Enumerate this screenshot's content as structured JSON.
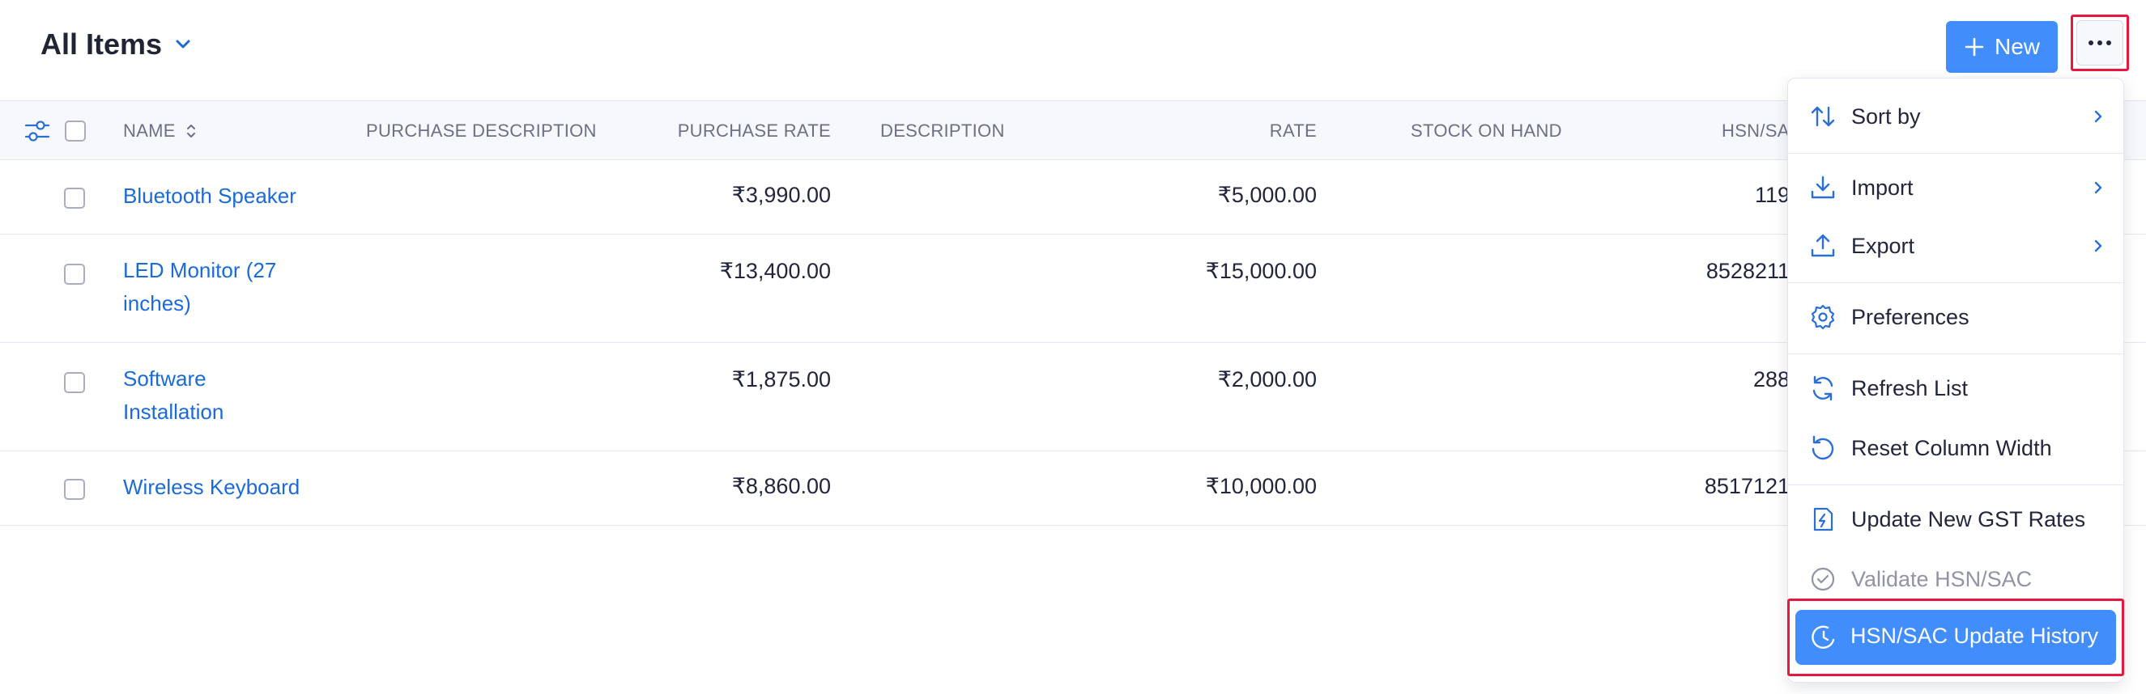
{
  "header": {
    "title": "All Items",
    "new_button_label": "New"
  },
  "table": {
    "columns": {
      "name": "NAME",
      "purchase_description": "PURCHASE DESCRIPTION",
      "purchase_rate": "PURCHASE RATE",
      "description": "DESCRIPTION",
      "rate": "RATE",
      "stock_on_hand": "STOCK ON HAND",
      "hsn_sac": "HSN/SAC"
    },
    "rows": [
      {
        "name": "Bluetooth Speaker",
        "purchase_rate": "₹3,990.00",
        "rate": "₹5,000.00",
        "hsn": "119"
      },
      {
        "name": "LED Monitor (27 inches)",
        "purchase_rate": "₹13,400.00",
        "rate": "₹15,000.00",
        "hsn": "8528211"
      },
      {
        "name": "Software Installation",
        "purchase_rate": "₹1,875.00",
        "rate": "₹2,000.00",
        "hsn": "288"
      },
      {
        "name": "Wireless Keyboard",
        "purchase_rate": "₹8,860.00",
        "rate": "₹10,000.00",
        "hsn": "8517121"
      }
    ]
  },
  "menu": {
    "sort_by": "Sort by",
    "import": "Import",
    "export": "Export",
    "preferences": "Preferences",
    "refresh_list": "Refresh List",
    "reset_column_width": "Reset Column Width",
    "update_gst_rates": "Update New GST Rates",
    "validate_hsn": "Validate HSN/SAC",
    "hsn_update_history": "HSN/SAC Update History"
  },
  "colors": {
    "accent": "#408dfb",
    "link": "#1a6ad8",
    "highlight_border": "#e8173e"
  }
}
